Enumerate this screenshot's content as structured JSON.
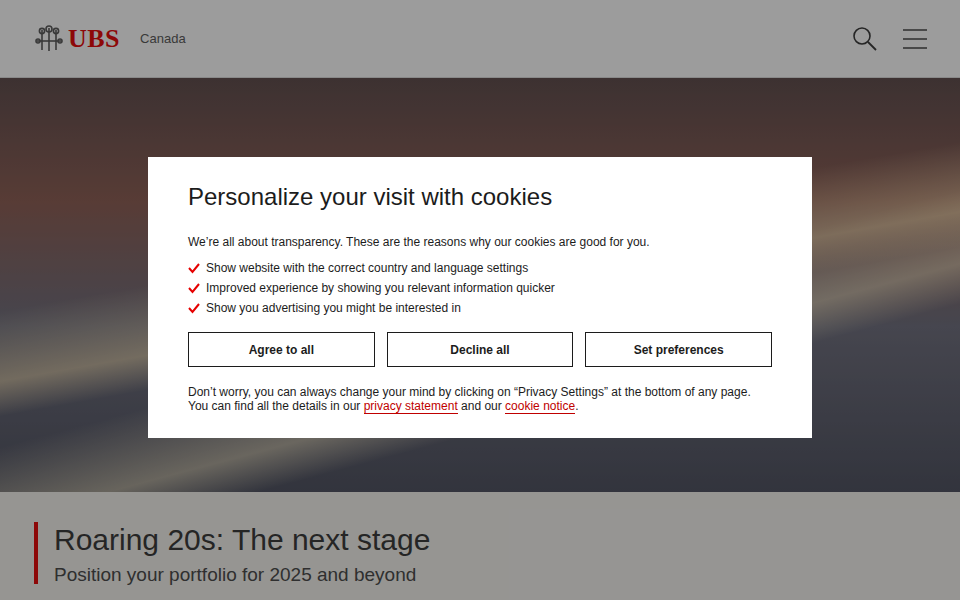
{
  "header": {
    "logo": "UBS",
    "region": "Canada"
  },
  "intro": {
    "title": "Roaring 20s: The next stage",
    "subtitle": "Position your portfolio for 2025 and beyond"
  },
  "cookie_dialog": {
    "title": "Personalize your visit with cookies",
    "intro": "We’re all about transparency. These are the reasons why our cookies are good for you.",
    "benefits": [
      "Show website with the correct country and language settings",
      "Improved experience by showing you relevant information quicker",
      "Show you advertising you might be interested in"
    ],
    "buttons": [
      "Agree to all",
      "Decline all",
      "Set preferences"
    ],
    "note_start": "Don’t worry, you can always change your mind by clicking on “Privacy Settings” at the bottom of any page. You can find all the details in our ",
    "privacy_link": "privacy statement",
    "note_middle": " and our ",
    "cookie_link": "cookie notice",
    "note_end": "."
  }
}
